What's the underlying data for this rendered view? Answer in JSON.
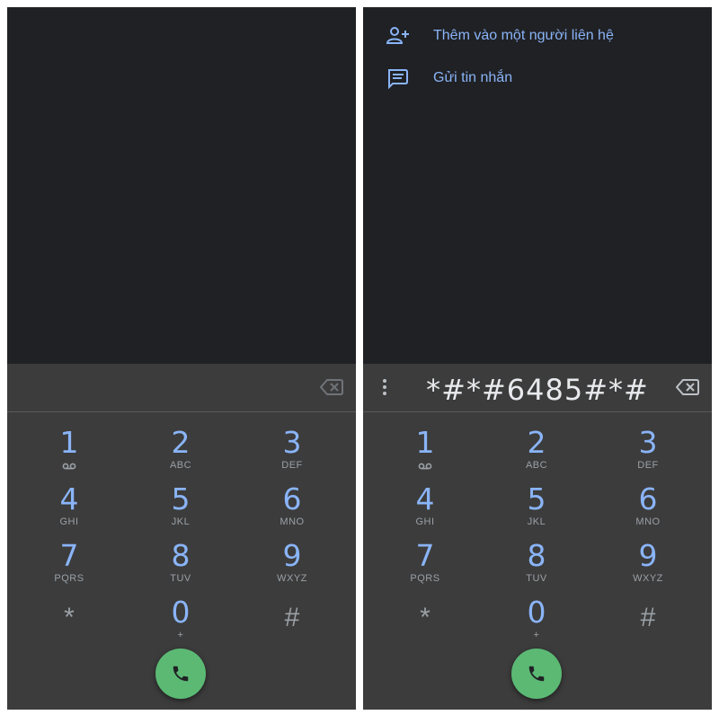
{
  "left": {
    "digits": "",
    "keypad": [
      {
        "digit": "1",
        "letters": "",
        "icon": "voicemail-icon"
      },
      {
        "digit": "2",
        "letters": "ABC"
      },
      {
        "digit": "3",
        "letters": "DEF"
      },
      {
        "digit": "4",
        "letters": "GHI"
      },
      {
        "digit": "5",
        "letters": "JKL"
      },
      {
        "digit": "6",
        "letters": "MNO"
      },
      {
        "digit": "7",
        "letters": "PQRS"
      },
      {
        "digit": "8",
        "letters": "TUV"
      },
      {
        "digit": "9",
        "letters": "WXYZ"
      },
      {
        "digit": "*",
        "letters": ""
      },
      {
        "digit": "0",
        "letters": "+"
      },
      {
        "digit": "#",
        "letters": ""
      }
    ]
  },
  "right": {
    "menu": [
      {
        "label": "Thêm vào một người liên hệ",
        "icon": "add-contact-icon"
      },
      {
        "label": "Gửi tin nhắn",
        "icon": "message-icon"
      }
    ],
    "digits": "*#*#6485#*#",
    "keypad": [
      {
        "digit": "1",
        "letters": "",
        "icon": "voicemail-icon"
      },
      {
        "digit": "2",
        "letters": "ABC"
      },
      {
        "digit": "3",
        "letters": "DEF"
      },
      {
        "digit": "4",
        "letters": "GHI"
      },
      {
        "digit": "5",
        "letters": "JKL"
      },
      {
        "digit": "6",
        "letters": "MNO"
      },
      {
        "digit": "7",
        "letters": "PQRS"
      },
      {
        "digit": "8",
        "letters": "TUV"
      },
      {
        "digit": "9",
        "letters": "WXYZ"
      },
      {
        "digit": "*",
        "letters": ""
      },
      {
        "digit": "0",
        "letters": "+"
      },
      {
        "digit": "#",
        "letters": ""
      }
    ]
  },
  "colors": {
    "background": "#202124",
    "dialer": "#3c3c3c",
    "accent": "#8ab4f8",
    "call_button": "#5bb974",
    "secondary_text": "#9aa0a6"
  }
}
